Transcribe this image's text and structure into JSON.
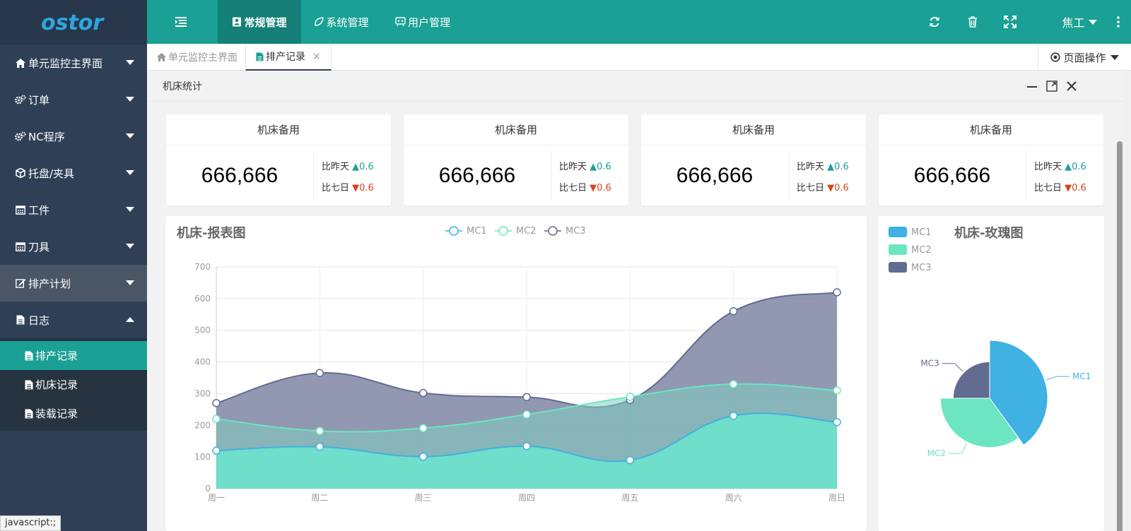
{
  "logo": {
    "text": "ostor"
  },
  "sidebar": {
    "items": [
      {
        "label": "单元监控主界面",
        "icon": "home-icon"
      },
      {
        "label": "订单",
        "icon": "cogs-icon"
      },
      {
        "label": "NC程序",
        "icon": "cogs-icon"
      },
      {
        "label": "托盘/夹具",
        "icon": "cube-icon"
      },
      {
        "label": "工件",
        "icon": "calendar-icon"
      },
      {
        "label": "刀具",
        "icon": "calendar-icon"
      },
      {
        "label": "排产计划",
        "icon": "edit-icon"
      },
      {
        "label": "日志",
        "icon": "file-icon"
      }
    ],
    "sub_items": [
      {
        "label": "排产记录",
        "icon": "file-icon"
      },
      {
        "label": "机床记录",
        "icon": "file-icon"
      },
      {
        "label": "装载记录",
        "icon": "file-icon"
      }
    ]
  },
  "status_tip": "javascript:;",
  "topbar": {
    "menus": [
      {
        "label": "常规管理",
        "icon": "address-card-icon"
      },
      {
        "label": "系统管理",
        "icon": "leaf-icon"
      },
      {
        "label": "用户管理",
        "icon": "snowflake-icon"
      }
    ],
    "user": "焦工"
  },
  "tabs": [
    {
      "label": "单元监控主界面",
      "icon": "home-icon"
    },
    {
      "label": "排产记录",
      "icon": "file-icon",
      "close": "×"
    }
  ],
  "page_ops": "页面操作",
  "panel": {
    "title": "机床统计"
  },
  "stats": [
    {
      "title": "机床备用",
      "value": "666,666",
      "cmp1_label": "比昨天",
      "cmp1_arrow": "▲",
      "cmp1_value": "0.6",
      "cmp2_label": "比七日",
      "cmp2_arrow": "▼",
      "cmp2_value": "0.6"
    },
    {
      "title": "机床备用",
      "value": "666,666",
      "cmp1_label": "比昨天",
      "cmp1_arrow": "▲",
      "cmp1_value": "0.6",
      "cmp2_label": "比七日",
      "cmp2_arrow": "▼",
      "cmp2_value": "0.6"
    },
    {
      "title": "机床备用",
      "value": "666,666",
      "cmp1_label": "比昨天",
      "cmp1_arrow": "▲",
      "cmp1_value": "0.6",
      "cmp2_label": "比七日",
      "cmp2_arrow": "▼",
      "cmp2_value": "0.6"
    },
    {
      "title": "机床备用",
      "value": "666,666",
      "cmp1_label": "比昨天",
      "cmp1_arrow": "▲",
      "cmp1_value": "0.6",
      "cmp2_label": "比七日",
      "cmp2_arrow": "▼",
      "cmp2_value": "0.6"
    }
  ],
  "colors": {
    "primary": "#1aa094",
    "sidebar": "#2f4056",
    "mc1": "#3fb1e3",
    "mc2": "#6be6c1",
    "mc3": "#626c91",
    "up": "#1aa094",
    "down": "#d9441c"
  },
  "chart_data": [
    {
      "type": "area",
      "title": "机床-报表图",
      "categories": [
        "周一",
        "周二",
        "周三",
        "周四",
        "周五",
        "周六",
        "周日"
      ],
      "ylim": [
        0,
        700
      ],
      "yticks": [
        0,
        100,
        200,
        300,
        400,
        500,
        600,
        700
      ],
      "grid": true,
      "legend": "top-center",
      "series": [
        {
          "name": "MC1",
          "values": [
            120,
            132,
            101,
            134,
            90,
            230,
            210
          ]
        },
        {
          "name": "MC2",
          "values": [
            220,
            182,
            191,
            234,
            290,
            330,
            310
          ]
        },
        {
          "name": "MC3",
          "values": [
            270,
            365,
            302,
            289,
            280,
            560,
            620
          ]
        }
      ]
    },
    {
      "type": "pie",
      "title": "机床-玫瑰图",
      "legend": "top-left",
      "series": [
        {
          "name": "MC1",
          "value": 40,
          "radius_frac": 1.0
        },
        {
          "name": "MC2",
          "value": 35,
          "radius_frac": 0.85
        },
        {
          "name": "MC3",
          "value": 25,
          "radius_frac": 0.63
        }
      ]
    }
  ]
}
